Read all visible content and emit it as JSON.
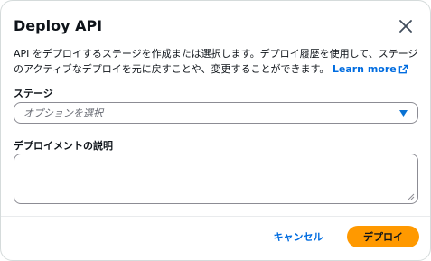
{
  "modal": {
    "title": "Deploy API",
    "description": "API をデプロイするステージを作成または選択します。デプロイ履歴を使用して、ステージのアクティブなデプロイを元に戻すことや、変更することができます。",
    "learn_more": "Learn more",
    "stage": {
      "label": "ステージ",
      "placeholder": "オプションを選択"
    },
    "deployment_description": {
      "label": "デプロイメントの説明",
      "value": ""
    },
    "buttons": {
      "cancel": "キャンセル",
      "deploy": "デプロイ"
    }
  },
  "icons": {
    "close": "close-icon",
    "external": "external-link-icon",
    "caret": "caret-down-icon",
    "resize": "resize-grip-icon"
  },
  "colors": {
    "link": "#006ce0",
    "primary_button": "#ff9900",
    "text": "#0f141a",
    "placeholder": "#656871",
    "border": "#8c8c94"
  }
}
